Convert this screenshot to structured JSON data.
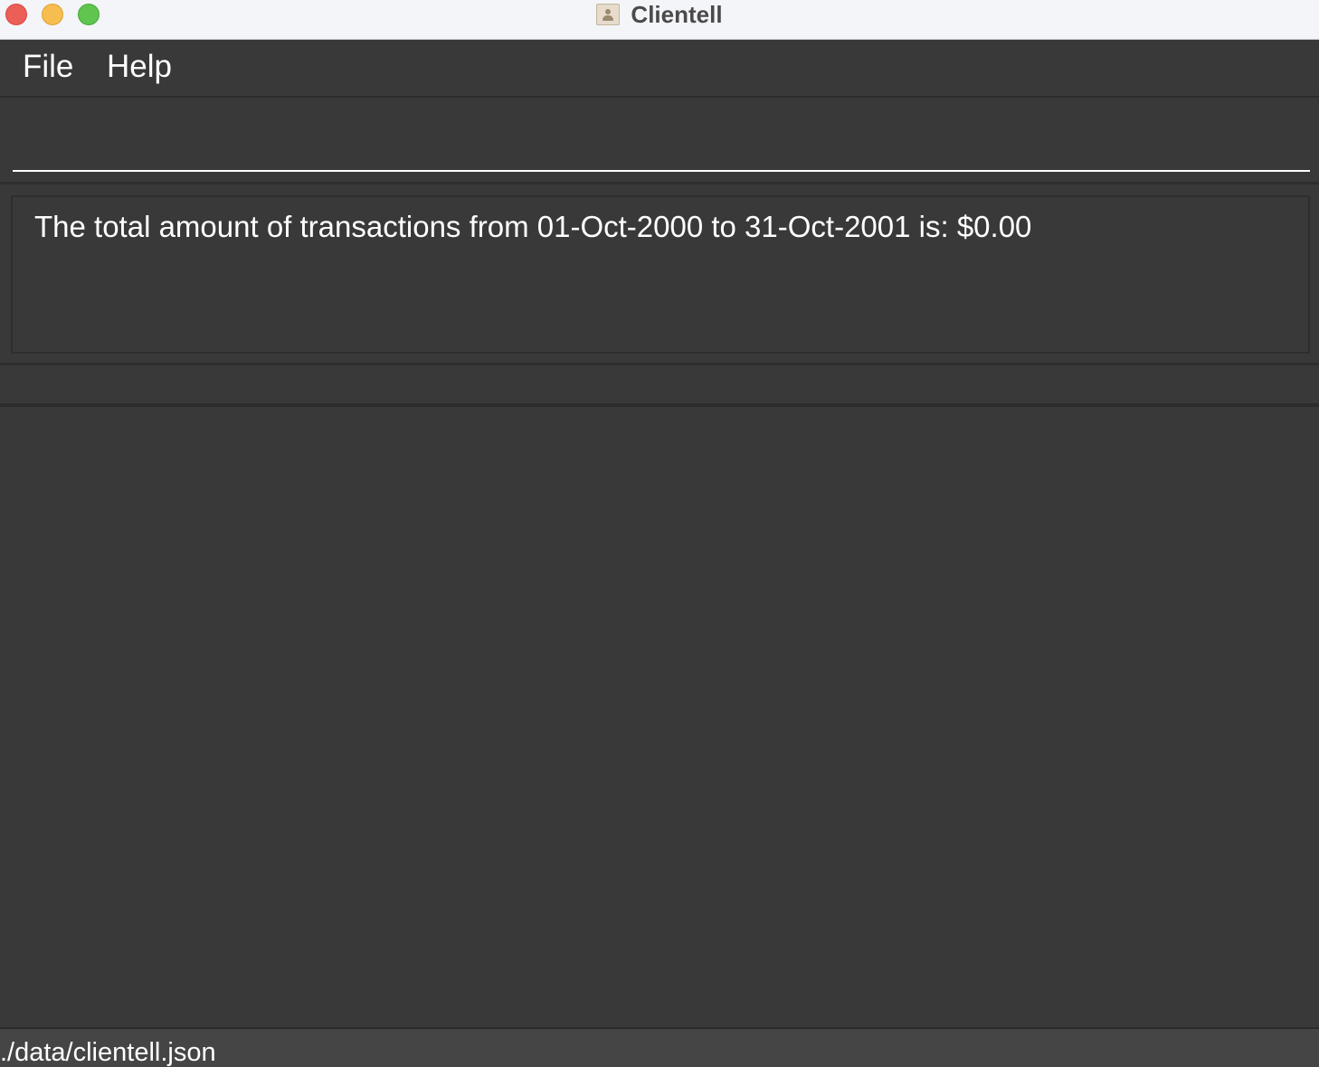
{
  "window": {
    "title": "Clientell"
  },
  "menu": {
    "file_label": "File",
    "help_label": "Help"
  },
  "command": {
    "value": "",
    "placeholder": ""
  },
  "result": {
    "message": "The total amount of transactions from 01-Oct-2000 to 31-Oct-2001 is: $0.00"
  },
  "status": {
    "file_path": "./data/clientell.json"
  },
  "icons": {
    "app": "contacts-app-icon"
  },
  "colors": {
    "background": "#393939",
    "titlebar": "#f4f5f8",
    "text": "#ffffff",
    "close": "#ec5f57",
    "minimize": "#f5be4f",
    "maximize": "#5fc54f"
  }
}
